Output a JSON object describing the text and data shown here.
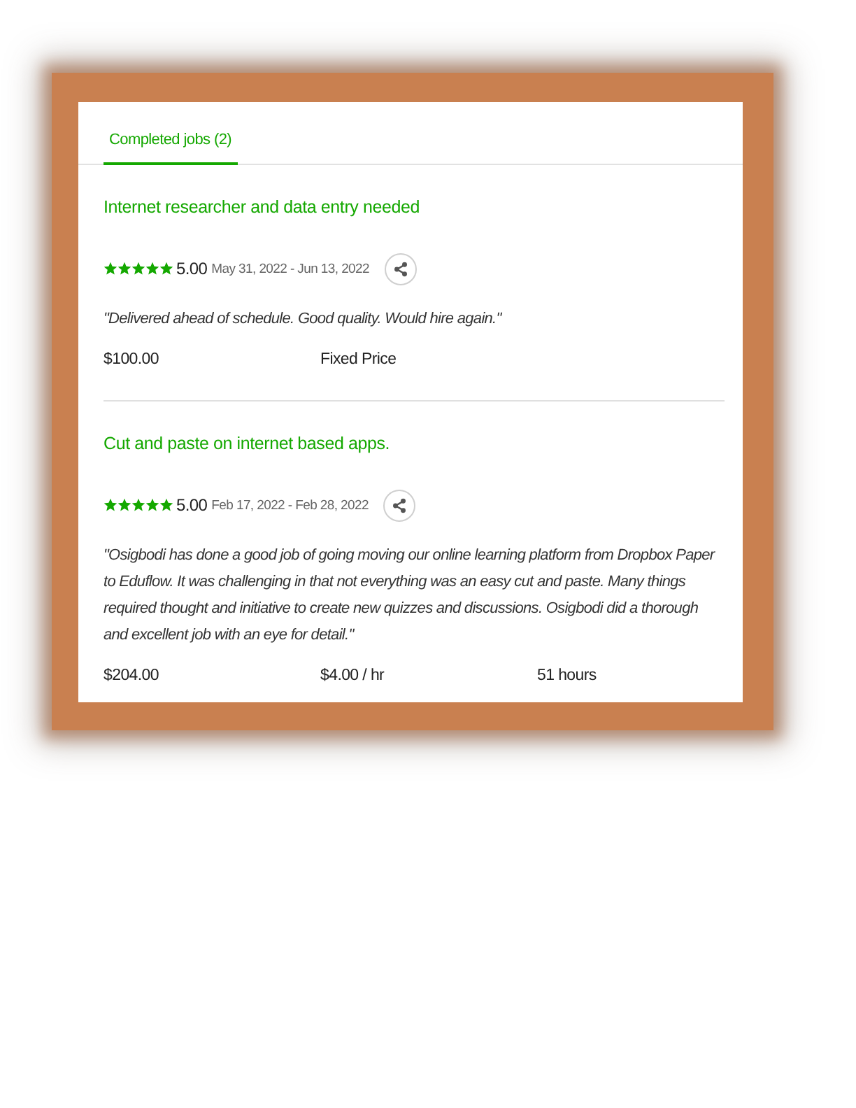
{
  "tabs": [
    {
      "label": "Completed jobs (2)",
      "selected": true
    }
  ],
  "jobs": [
    {
      "title": "Internet researcher and data entry needed",
      "stars": 5,
      "rating": "5.00",
      "dates": "May 31, 2022 - Jun 13, 2022",
      "feedback": "\"Delivered ahead of schedule. Good quality. Would hire again.\"",
      "earned": "$100.00",
      "rate": "Fixed Price"
    },
    {
      "title": "Cut and paste on internet based apps.",
      "stars": 5,
      "rating": "5.00",
      "dates": "Feb 17, 2022 - Feb 28, 2022",
      "feedback": "\"Osigbodi has done a good job of going moving our online learning platform from Dropbox Paper to Eduflow. It was challenging in that not everything was an easy cut and paste. Many things required thought and initiative to create new quizzes and discussions. Osigbodi did a thorough and excellent job with an eye for detail.\"",
      "earned": "$204.00",
      "rate": "$4.00 / hr",
      "hours": "51 hours"
    }
  ]
}
